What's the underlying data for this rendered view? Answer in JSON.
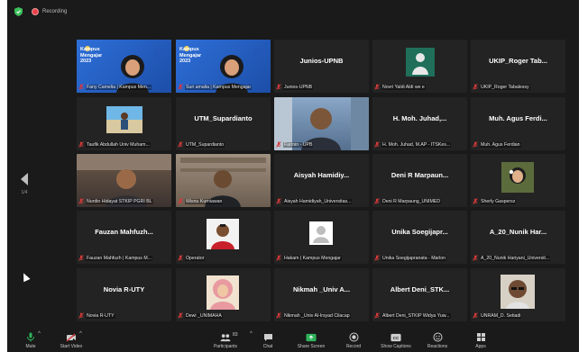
{
  "window": {
    "recording_label": "Recording"
  },
  "navigation": {
    "page_indicator": "1/4"
  },
  "participants": [
    {
      "display": "Kampus Mengajar 2023",
      "name": "Fany Camelia | Kampus Men...",
      "video": "blue-woman",
      "active": true
    },
    {
      "display": "Kampus Mengajar 2023",
      "name": "Suri amalia | Kampus Mengajar",
      "video": "blue-woman2",
      "active": false
    },
    {
      "display": "Junios-UPNB",
      "name": "Junios-UPNB",
      "video": "none",
      "active": false
    },
    {
      "display": "",
      "name": "Novri Yaldi Aldi we e",
      "video": "avatar-green",
      "active": false
    },
    {
      "display": "UKIP_Roger Tab...",
      "name": "UKIP_Roger Tabalessy",
      "video": "none",
      "active": false
    },
    {
      "display": "",
      "name": "Taufik Abdullah Univ Muham...",
      "video": "avatar-beach",
      "active": false
    },
    {
      "display": "UTM_Supardianto",
      "name": "UTM_Supardianto",
      "video": "none",
      "active": false
    },
    {
      "display": "",
      "name": "Farmin - UPB",
      "video": "man-office",
      "active": false
    },
    {
      "display": "H. Moh. Juhad,...",
      "name": "H. Moh. Juhad, M.AP - ITSKes...",
      "video": "none",
      "active": false
    },
    {
      "display": "Muh. Agus Ferdi...",
      "name": "Muh. Agus Ferdian",
      "video": "none",
      "active": false
    },
    {
      "display": "",
      "name": "Nurdin Hidayat STKIP PGRI BL",
      "video": "man-room",
      "active": false
    },
    {
      "display": "",
      "name": "Wisnu Kurniawan",
      "video": "man-shelf",
      "active": false
    },
    {
      "display": "Aisyah Hamidiy...",
      "name": "Aisyah Hamidiyah_Universitas...",
      "video": "none",
      "active": false
    },
    {
      "display": "Deni R Marpaun...",
      "name": "Deni R Marpaung_UNIMED",
      "video": "none",
      "active": false
    },
    {
      "display": "",
      "name": "Sherly Gaspersz",
      "video": "avatar-girl",
      "active": false
    },
    {
      "display": "Fauzan Mahfuzh...",
      "name": "Fauzan Mahfuzh | Kampus M...",
      "video": "none",
      "active": false
    },
    {
      "display": "",
      "name": "Operator",
      "video": "avatar-man",
      "active": false
    },
    {
      "display": "",
      "name": "Hakam | Kampus Mengajar",
      "video": "avatar-blank",
      "active": false
    },
    {
      "display": "Unika Soegijapr...",
      "name": "Unika Soegijapranata - Marlon",
      "video": "none",
      "active": false
    },
    {
      "display": "A_20_Nunik Har...",
      "name": "A_20_Nunik Hariyani_Universit...",
      "video": "none",
      "active": false
    },
    {
      "display": "Novia R-UTY",
      "name": "Novia R-UTY",
      "video": "none",
      "active": false
    },
    {
      "display": "",
      "name": "Dewi _UNIMAHA",
      "video": "avatar-hijab",
      "active": false
    },
    {
      "display": "Nikmah _Univ A...",
      "name": "Nikmah _Univ Al-Irsyad Cilacap",
      "video": "none",
      "active": false
    },
    {
      "display": "Albert Deni_STK...",
      "name": "Albert Deni_STKIP Widya Yuw...",
      "video": "none",
      "active": false
    },
    {
      "display": "",
      "name": "UNRAM_D. Setiadi",
      "video": "avatar-glasses",
      "active": false
    }
  ],
  "toolbar": {
    "participants_count": "83",
    "items": [
      {
        "id": "mute",
        "label": "Mute",
        "icon": "microphone-icon"
      },
      {
        "id": "video",
        "label": "Start Video",
        "icon": "video-off-icon"
      },
      {
        "id": "participants",
        "label": "Participants",
        "icon": "participants-icon"
      },
      {
        "id": "chat",
        "label": "Chat",
        "icon": "chat-icon"
      },
      {
        "id": "share",
        "label": "Share Screen",
        "icon": "share-screen-icon"
      },
      {
        "id": "record",
        "label": "Record",
        "icon": "record-icon"
      },
      {
        "id": "captions",
        "label": "Show Captions",
        "icon": "captions-icon"
      },
      {
        "id": "reactions",
        "label": "Reactions",
        "icon": "reactions-icon"
      },
      {
        "id": "apps",
        "label": "Apps",
        "icon": "apps-icon"
      }
    ]
  },
  "colors": {
    "background": "#1a1a1a",
    "tile": "#232323",
    "active_border": "#d8d24a",
    "record": "#e8414a",
    "mute_red": "#d63a3a",
    "share_green": "#2fb35a"
  }
}
